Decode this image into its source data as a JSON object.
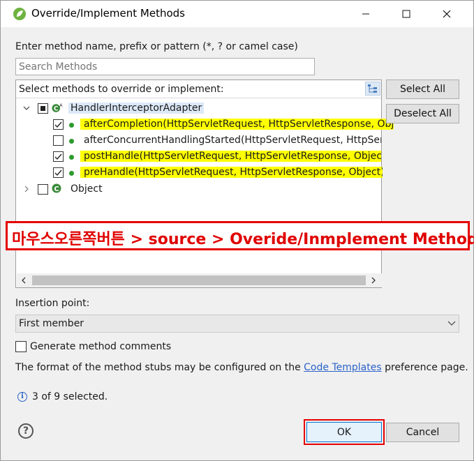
{
  "window": {
    "title": "Override/Implement Methods",
    "icon": "spring-leaf-icon",
    "controls": [
      "minimize-icon",
      "maximize-icon",
      "close-icon"
    ]
  },
  "filter": {
    "label": "Enter method name, prefix or pattern (*, ? or camel case)",
    "placeholder": "Search Methods"
  },
  "tree": {
    "header": "Select methods to override or implement:",
    "sort_icon": "sort-hierarchy-icon",
    "root": {
      "label": "HandlerInterceptorAdapter",
      "expanded": true,
      "checked": "partial",
      "methods": [
        {
          "label": "afterCompletion(HttpServletRequest, HttpServletResponse, Obj",
          "checked": true,
          "highlight": true
        },
        {
          "label": "afterConcurrentHandlingStarted(HttpServletRequest, HttpServle",
          "checked": false,
          "highlight": false
        },
        {
          "label": "postHandle(HttpServletRequest, HttpServletResponse, Object, M",
          "checked": true,
          "highlight": true
        },
        {
          "label": "preHandle(HttpServletRequest, HttpServletResponse, Object)",
          "checked": true,
          "highlight": true
        }
      ]
    },
    "second": {
      "label": "Object",
      "expanded": false,
      "checked": false
    }
  },
  "annotation": "마우스오른쪽버튼 > source > Overide/Inmplement Methods",
  "buttons": {
    "select_all": "Select All",
    "deselect_all": "Deselect All",
    "ok": "OK",
    "cancel": "Cancel"
  },
  "insertion": {
    "label": "Insertion point:",
    "value": "First member"
  },
  "generate_comments": {
    "label": "Generate method comments",
    "checked": false
  },
  "note": {
    "prefix": "The format of the method stubs may be configured on the ",
    "link": "Code Templates",
    "suffix": " preference page."
  },
  "status": "3 of 9 selected.",
  "colors": {
    "highlight": "#ffff00",
    "annotation_red": "#e60000",
    "link_blue": "#2a62c9",
    "method_dot": "#2d9a2d"
  }
}
